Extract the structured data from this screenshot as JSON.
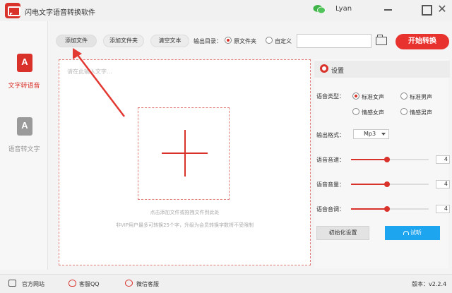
{
  "window": {
    "title": "闪电文字语音转换软件",
    "user": "Lyan",
    "close_glyph": "✕"
  },
  "sidebar": {
    "items": [
      {
        "icon": "text-to-speech-icon",
        "glyph": "A",
        "label": "文字转语音",
        "active": true
      },
      {
        "icon": "speech-to-text-icon",
        "glyph": "A",
        "label": "语音转文字",
        "active": false
      }
    ]
  },
  "toolbar": {
    "add_file": "添加文件",
    "add_folder": "添加文件夹",
    "clear_text": "清空文本",
    "output_dir_label": "输出目录：",
    "output_options": [
      "原文件夹",
      "自定义"
    ],
    "output_selected": "原文件夹",
    "path_value": "",
    "start": "开始转换"
  },
  "editor": {
    "placeholder": "请在此输入文字...",
    "hint_add": "点击添加文件或拖拽文件到此处",
    "hint_vip": "非VIP用户最多可转换25个字，升级为会员转换字数将不受限制"
  },
  "settings": {
    "title": "设置",
    "voice_type_label": "语音类型：",
    "voice_options": [
      "标准女声",
      "标准男声",
      "情感女声",
      "情感男声"
    ],
    "voice_selected": "标准女声",
    "format_label": "输出格式：",
    "format_value": "Mp3",
    "speed_label": "语音音速：",
    "speed_value": "4",
    "volume_label": "语音音量：",
    "volume_value": "4",
    "pitch_label": "语音音调：",
    "pitch_value": "4",
    "slider_level": 0.46,
    "reset": "初始化设置",
    "listen": "试听"
  },
  "footer": {
    "website": "官方网站",
    "qq": "客服QQ",
    "wechat": "微信客服",
    "version": "版本：v2.2.4"
  },
  "colors": {
    "accent": "#d9322b",
    "start": "#e8322e",
    "listen": "#1ea5f0"
  }
}
